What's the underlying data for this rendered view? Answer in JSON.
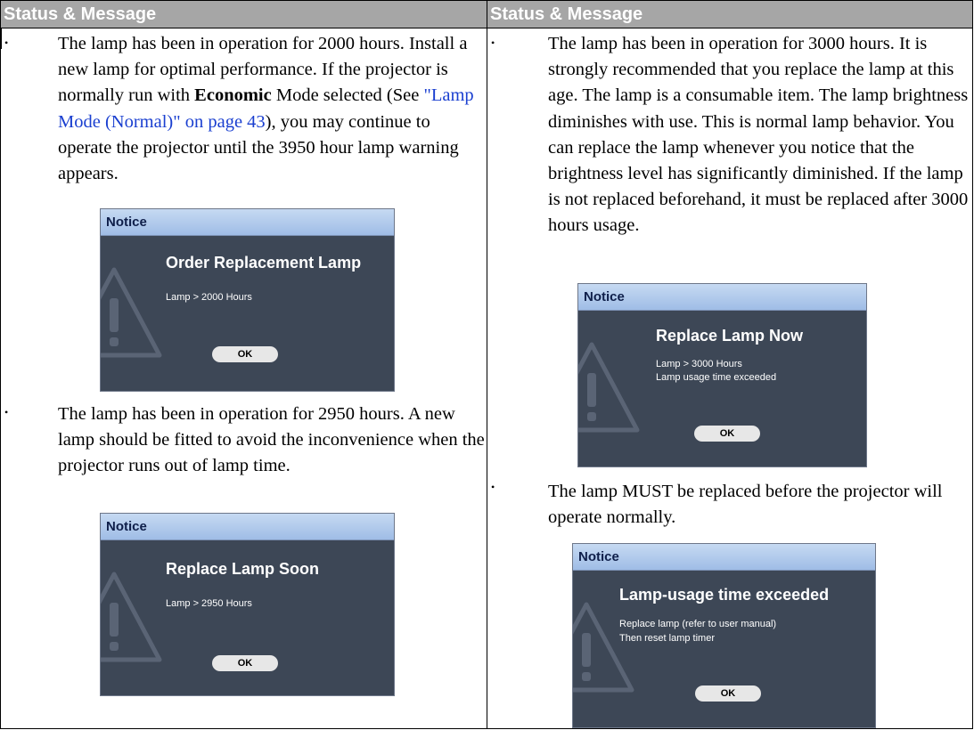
{
  "headers": {
    "left": "Status & Message",
    "right": "Status & Message"
  },
  "bullet_char": "•",
  "left": {
    "p1": {
      "before_bold": "The lamp has been in operation for 2000 hours. Install a new lamp for optimal performance. If the projector is normally run with ",
      "bold": "Economic",
      "middle": " Mode selected (See ",
      "link": "\"Lamp Mode (Normal)\" on page 43",
      "after": "), you may continue to operate the projector until the 3950 hour lamp warning appears."
    },
    "notice1": {
      "title": "Notice",
      "heading": "Order Replacement Lamp",
      "line1": "Lamp > 2000 Hours",
      "ok": "OK"
    },
    "p2": "The lamp has been in operation for 2950 hours. A new lamp should be fitted to avoid the inconvenience when the projector runs out of lamp time.",
    "notice2": {
      "title": "Notice",
      "heading": "Replace Lamp Soon",
      "line1": "Lamp > 2950 Hours",
      "ok": "OK"
    }
  },
  "right": {
    "p1": "The lamp has been in operation for 3000 hours. It is strongly recommended that you replace the lamp at this age. The lamp is a consumable item. The lamp brightness diminishes with use. This is normal lamp behavior. You can replace the lamp whenever you notice that the brightness level has significantly diminished. If the lamp is not replaced beforehand, it must be replaced after 3000 hours usage.",
    "notice3": {
      "title": "Notice",
      "heading": "Replace Lamp Now",
      "line1": "Lamp > 3000 Hours",
      "line2": "Lamp usage time exceeded",
      "ok": "OK"
    },
    "p2": "The lamp MUST be replaced before the projector will operate normally.",
    "notice4": {
      "title": "Notice",
      "heading": "Lamp-usage time exceeded",
      "line1": "Replace lamp (refer to user manual)",
      "line2": "Then reset lamp timer",
      "ok": "OK"
    }
  },
  "colors": {
    "header_bg": "#a6a6a6",
    "dialog_bg": "#3d4756",
    "link": "#1a3fd0",
    "title_bar": "#b3cdee"
  },
  "icons": {
    "dialog_watermark": "warning-triangle-icon"
  }
}
